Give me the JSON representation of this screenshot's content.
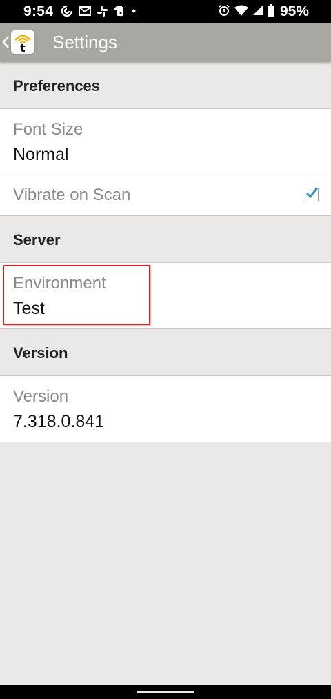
{
  "status_bar": {
    "time": "9:54",
    "battery": "95%",
    "left_icons": [
      "sync-icon",
      "gmail-icon",
      "slack-icon",
      "evernote-icon",
      "dot-icon"
    ],
    "right_icons": [
      "alarm-icon",
      "wifi-icon",
      "cellular-icon",
      "battery-icon"
    ]
  },
  "app_bar": {
    "title": "Settings",
    "icons": [
      "back-chevron-icon",
      "app-logo-icon"
    ],
    "logo_letter": "t"
  },
  "sections": {
    "preferences": {
      "header": "Preferences",
      "font_size": {
        "title": "Font Size",
        "value": "Normal"
      },
      "vibrate": {
        "title": "Vibrate on Scan",
        "checked": true
      }
    },
    "server": {
      "header": "Server",
      "environment": {
        "title": "Environment",
        "value": "Test"
      }
    },
    "version": {
      "header": "Version",
      "version_item": {
        "title": "Version",
        "value": "7.318.0.841"
      }
    }
  },
  "colors": {
    "app_bar": "#a8a8a3",
    "background": "#ebe8e5",
    "checkbox_accent": "#3a8fc7",
    "highlight": "#d32020",
    "logo_arc": "#f0b400"
  }
}
